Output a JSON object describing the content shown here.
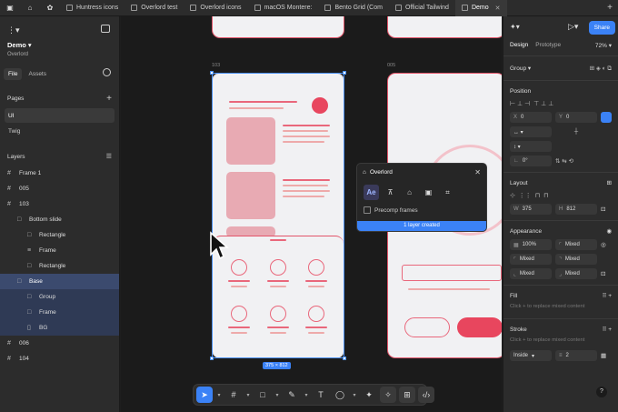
{
  "tabs": [
    {
      "label": "Huntress icons",
      "active": false
    },
    {
      "label": "Overlord test",
      "active": false
    },
    {
      "label": "Overlord icons",
      "active": false
    },
    {
      "label": "macOS Montere:",
      "active": false
    },
    {
      "label": "Bento Grid (Com",
      "active": false
    },
    {
      "label": "Official Tailwind",
      "active": false
    },
    {
      "label": "Demo",
      "active": true
    }
  ],
  "left": {
    "project_name": "Demo",
    "project_sub": "Overlord",
    "tab_file": "File",
    "tab_assets": "Assets",
    "pages_title": "Pages",
    "pages": [
      {
        "label": "UI",
        "active": true
      },
      {
        "label": "Twig",
        "active": false
      }
    ],
    "layers_title": "Layers",
    "layers": [
      {
        "label": "Frame 1",
        "indent": 0,
        "icon": "#",
        "state": ""
      },
      {
        "label": "005",
        "indent": 0,
        "icon": "#",
        "state": ""
      },
      {
        "label": "103",
        "indent": 0,
        "icon": "#",
        "state": ""
      },
      {
        "label": "Bottom slide",
        "indent": 1,
        "icon": "□",
        "state": ""
      },
      {
        "label": "Rectangle",
        "indent": 2,
        "icon": "□",
        "state": ""
      },
      {
        "label": "Frame",
        "indent": 2,
        "icon": "≡",
        "state": ""
      },
      {
        "label": "Rectangle",
        "indent": 2,
        "icon": "□",
        "state": ""
      },
      {
        "label": "Base",
        "indent": 1,
        "icon": "□",
        "state": "sel"
      },
      {
        "label": "Group",
        "indent": 2,
        "icon": "□",
        "state": "sub"
      },
      {
        "label": "Frame",
        "indent": 2,
        "icon": "□",
        "state": "sub"
      },
      {
        "label": "BG",
        "indent": 2,
        "icon": "▯",
        "state": "sub"
      },
      {
        "label": "006",
        "indent": 0,
        "icon": "#",
        "state": ""
      },
      {
        "label": "104",
        "indent": 0,
        "icon": "#",
        "state": ""
      }
    ]
  },
  "canvas": {
    "label_103": "103",
    "label_005": "005",
    "size_badge": "375 × 812"
  },
  "plugin": {
    "title": "Overlord",
    "tool_ae": "Ae",
    "precomp_label": "Precomp frames",
    "status": "1 layer created"
  },
  "right": {
    "share": "Share",
    "tab_design": "Design",
    "tab_prototype": "Prototype",
    "zoom": "72%",
    "group_label": "Group",
    "position_title": "Position",
    "x_key": "X",
    "x_val": "0",
    "y_key": "Y",
    "y_val": "0",
    "rotation": "0°",
    "layout_title": "Layout",
    "w_key": "W",
    "w_val": "375",
    "h_key": "H",
    "h_val": "812",
    "appearance_title": "Appearance",
    "opacity": "100%",
    "radius_mixed": "Mixed",
    "mixed_a": "Mixed",
    "mixed_b": "Mixed",
    "mixed_c": "Mixed",
    "fill_title": "Fill",
    "fill_hint": "Click + to replace mixed content",
    "stroke_title": "Stroke",
    "stroke_hint": "Click + to replace mixed content",
    "stroke_pos": "Inside",
    "stroke_width": "2"
  },
  "colors": {
    "accent": "#3b82f6",
    "brand_red": "#e9677b"
  }
}
